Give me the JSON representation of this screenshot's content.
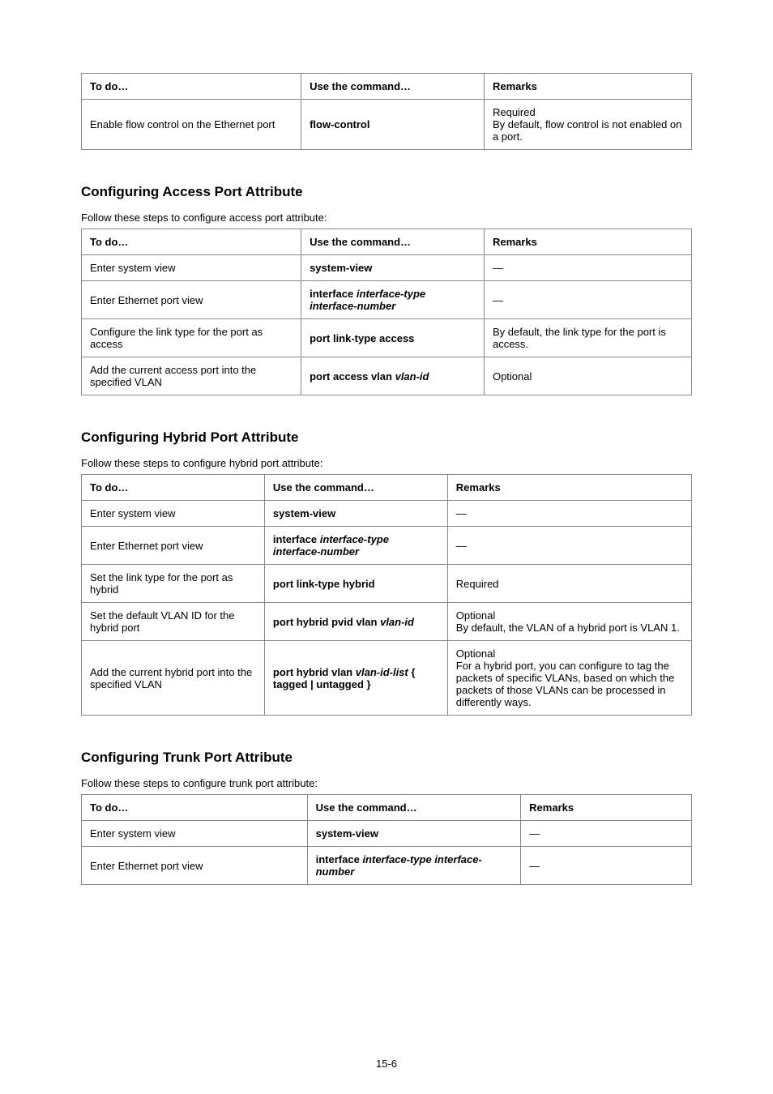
{
  "page_number": "15-6",
  "table1": {
    "headers": [
      "To do…",
      "Use the command…",
      "Remarks"
    ],
    "rows": [
      {
        "desc": "Enable flow control on the Ethernet port",
        "cmd_html": "<b>flow-control</b>",
        "remarks": "Required<br>By default, flow control is not enabled on a port."
      }
    ]
  },
  "section_access": {
    "heading": "Configuring Access Port Attribute",
    "intro": "Follow these steps to configure access port attribute:"
  },
  "table2": {
    "headers": [
      "To do…",
      "Use the command…",
      "Remarks"
    ],
    "rows": [
      {
        "desc": "Enter system view",
        "cmd_html": "<b>system-view</b>",
        "remarks": "—"
      },
      {
        "desc": "Enter Ethernet port view",
        "cmd_html": "<b>interface</b> <i>interface-type interface-number</i>",
        "remarks": "—"
      },
      {
        "desc": "Configure the link type for the port as access",
        "cmd_html": "<b>port link-type access</b>",
        "remarks": "By default, the link type for the port is access."
      },
      {
        "desc": "Add the current access port into the specified VLAN",
        "cmd_html": "<b>port access vlan</b> <i>vlan-id</i>",
        "remarks": "Optional"
      }
    ]
  },
  "section_hybrid": {
    "heading": "Configuring Hybrid Port Attribute",
    "intro": "Follow these steps to configure hybrid port attribute:"
  },
  "table3": {
    "headers": [
      "To do…",
      "Use the command…",
      "Remarks"
    ],
    "rows": [
      {
        "desc": "Enter system view",
        "cmd_html": "<b>system-view</b>",
        "remarks": "—"
      },
      {
        "desc": "Enter Ethernet port view",
        "cmd_html": "<b>interface</b> <i>interface-type interface-number</i>",
        "remarks": "—"
      },
      {
        "desc": "Set the link type for the port as hybrid",
        "cmd_html": "<b>port link-type hybrid</b>",
        "remarks": "Required"
      },
      {
        "desc": "Set the default VLAN ID for the hybrid port",
        "cmd_html": "<b>port hybrid pvid vlan</b> <i>vlan-id</i>",
        "remarks": "Optional<br>By default, the VLAN of a hybrid port is VLAN 1."
      },
      {
        "desc": "Add the current hybrid port into the specified VLAN",
        "cmd_html": "<b>port hybrid vlan</b> <i>vlan-id-list</i> { <b>tagged</b> | <b>untagged</b> }",
        "remarks": "Optional<br>For a hybrid port, you can configure to tag the packets of specific VLANs, based on which the packets of those VLANs can be processed in differently ways."
      }
    ]
  },
  "section_trunk": {
    "heading": "Configuring Trunk Port Attribute",
    "intro": "Follow these steps to configure trunk port attribute:"
  },
  "table4": {
    "headers": [
      "To do…",
      "Use the command…",
      "Remarks"
    ],
    "rows": [
      {
        "desc": "Enter system view",
        "cmd_html": "<b>system-view</b>",
        "remarks": "—"
      },
      {
        "desc": "Enter Ethernet port view",
        "cmd_html": "<b>interface</b> <i>interface-type interface-number</i>",
        "remarks": "—"
      }
    ]
  }
}
